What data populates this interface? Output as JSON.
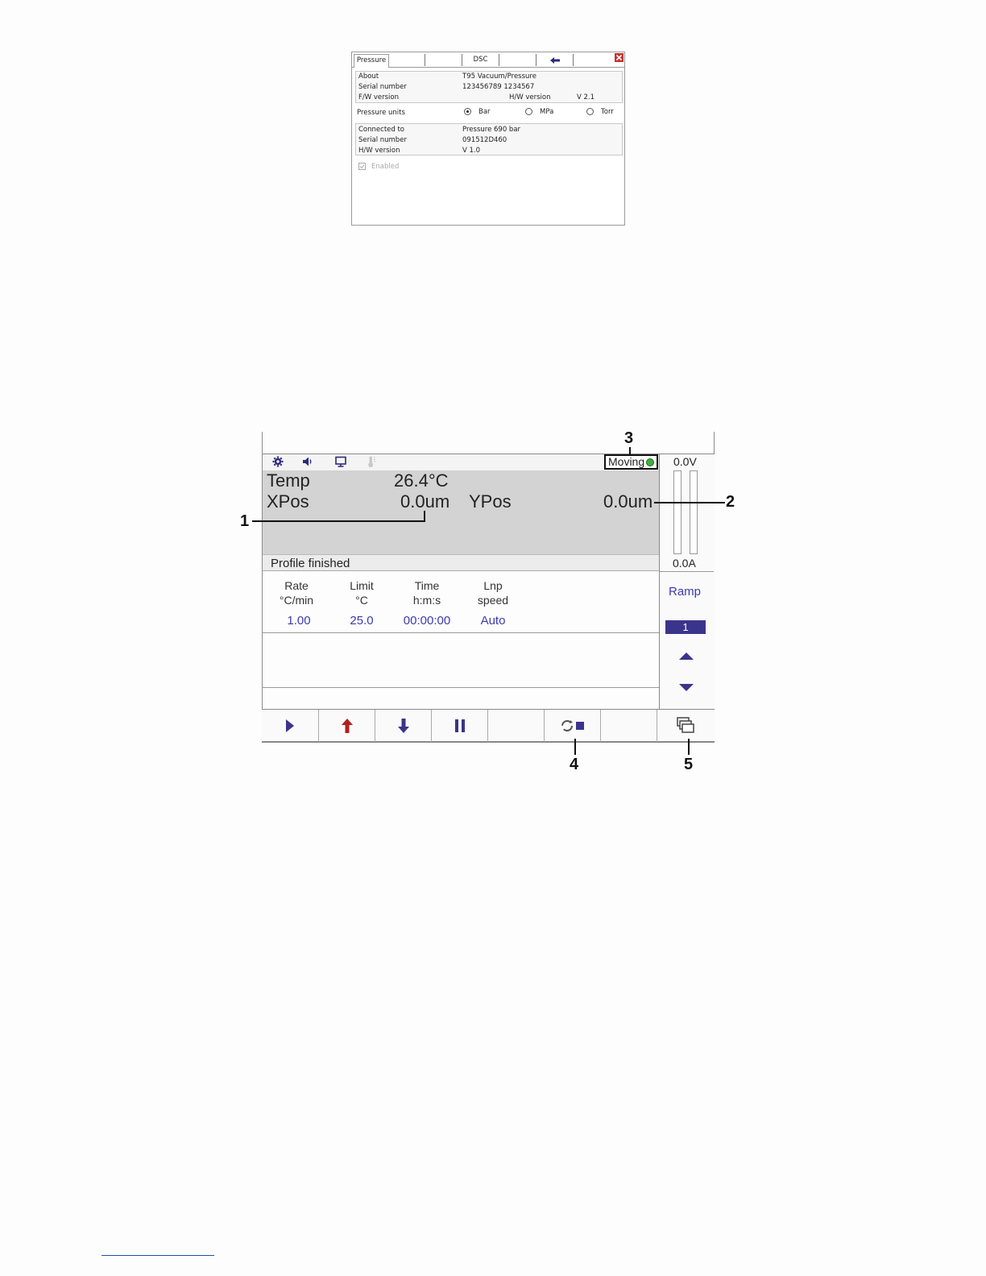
{
  "dialog": {
    "tabs": [
      "Pressure",
      "",
      "",
      "DSC",
      "",
      ""
    ],
    "about": {
      "label": "About",
      "value": "T95 Vacuum/Pressure",
      "serial_label": "Serial number",
      "serial_value": "123456789 1234567",
      "fw_label": "F/W version",
      "hw_label": "H/W version",
      "hw_value": "V 2.1"
    },
    "pressure_units": {
      "label": "Pressure units",
      "options": [
        "Bar",
        "MPa",
        "Torr"
      ],
      "selected": "Bar"
    },
    "connected": {
      "label": "Connected to",
      "value": "Pressure 690 bar",
      "serial_label": "Serial number",
      "serial_value": "091512D460",
      "hw_label": "H/W version",
      "hw_value": "V 1.0"
    },
    "enabled_label": "Enabled",
    "colors": {
      "close": "#c8322c",
      "arrow": "#2c2a7a"
    }
  },
  "controller": {
    "status_icons": [
      "gear-icon",
      "speaker-icon",
      "monitor-icon",
      "thermometer-icon"
    ],
    "moving_label": "Moving",
    "temp_label": "Temp",
    "temp_value": "26.4°C",
    "xpos_label": "XPos",
    "xpos_value": "0.0um",
    "ypos_label": "YPos",
    "ypos_value": "0.0um",
    "profile_status": "Profile finished",
    "columns": [
      {
        "line1": "Rate",
        "line2": "°C/min",
        "value": "1.00"
      },
      {
        "line1": "Limit",
        "line2": "°C",
        "value": "25.0"
      },
      {
        "line1": "Time",
        "line2": "h:m:s",
        "value": "00:00:00"
      },
      {
        "line1": "Lnp",
        "line2": "speed",
        "value": "Auto"
      }
    ],
    "voltage": "0.0V",
    "current": "0.0A",
    "ramp_label": "Ramp",
    "ramp_number": "1",
    "toolbar_icons": [
      "play-icon",
      "heat-up-arrow-icon",
      "cool-down-arrow-icon",
      "pause-icon",
      "empty",
      "cycle-stop-icon",
      "empty",
      "windows-icon"
    ],
    "colors": {
      "accent": "#3b348c",
      "value_text": "#3a3ab0",
      "heat": "#b21f1f",
      "led": "#3fae3f"
    }
  },
  "callouts": [
    "1",
    "2",
    "3",
    "4",
    "5"
  ]
}
